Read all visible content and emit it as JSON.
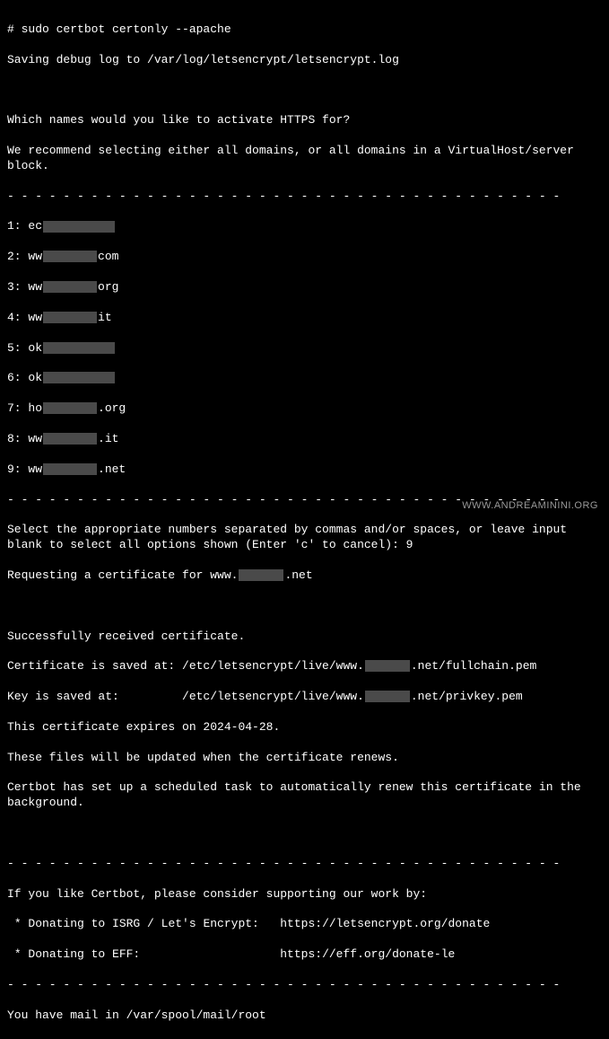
{
  "command": "# sudo certbot certonly --apache",
  "saving_log": "Saving debug log to /var/log/letsencrypt/letsencrypt.log",
  "question": "Which names would you like to activate HTTPS for?",
  "recommend": "We recommend selecting either all domains, or all domains in a VirtualHost/server block.",
  "dashes": "- - - - - - - - - - - - - - - - - - - - - - - - - - - - - - - - - - - - - - - -",
  "domains": {
    "d1_pre": "1: ec",
    "d2_pre": "2: ww",
    "d2_post": "com",
    "d3_pre": "3: ww",
    "d3_post": "org",
    "d4_pre": "4: ww",
    "d4_post": "it",
    "d5_pre": "5: ok",
    "d6_pre": "6: ok",
    "d7_pre": "7: ho",
    "d7_post": ".org",
    "d8_pre": "8: ww",
    "d8_post": ".it",
    "d9_pre": "9: ww",
    "d9_post": ".net"
  },
  "prompt": "Select the appropriate numbers separated by commas and/or spaces, or leave input blank to select all options shown (Enter 'c' to cancel): 9",
  "requesting_pre": "Requesting a certificate for www.",
  "requesting_post": ".net",
  "success": "Successfully received certificate.",
  "cert_pre": "Certificate is saved at: /etc/letsencrypt/live/www.",
  "cert_post": ".net/fullchain.pem",
  "key_pre": "Key is saved at:         /etc/letsencrypt/live/www.",
  "key_post": ".net/privkey.pem",
  "expires": "This certificate expires on 2024-04-28.",
  "renew_info": "These files will be updated when the certificate renews.",
  "scheduled": "Certbot has set up a scheduled task to automatically renew this certificate in the background.",
  "support_header": "If you like Certbot, please consider supporting our work by:",
  "donate_isrg": " * Donating to ISRG / Let's Encrypt:   https://letsencrypt.org/donate",
  "donate_eff": " * Donating to EFF:                    https://eff.org/donate-le",
  "mail": "You have mail in /var/spool/mail/root",
  "watermark": "WWW.ANDREAMININI.ORG"
}
